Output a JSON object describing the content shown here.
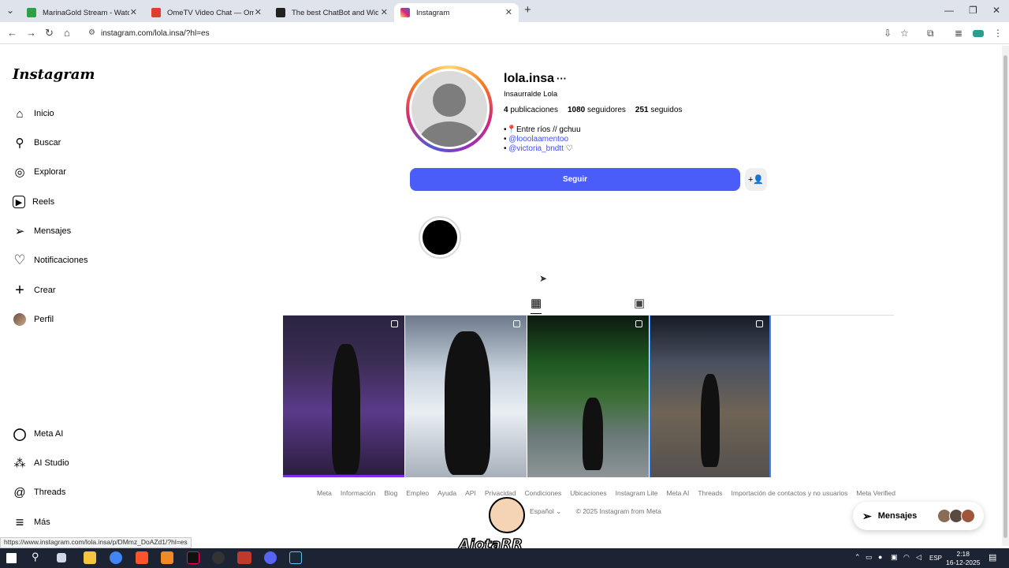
{
  "browser": {
    "tabs": [
      {
        "title": "MarinaGold Stream - Watch Liv",
        "color": "#2ea043"
      },
      {
        "title": "OmeTV Video Chat — Ome",
        "color": "#e03c31"
      },
      {
        "title": "The best ChatBot and Widgets",
        "color": "#222222"
      },
      {
        "title": "Instagram",
        "color": "#d62976"
      }
    ],
    "url": "instagram.com/lola.insa/?hl=es",
    "status_url": "https://www.instagram.com/lola.insa/p/DMmz_DoAZd1/?hl=es"
  },
  "sidebar": {
    "logo": "Instagram",
    "items": [
      {
        "label": "Inicio",
        "icon": "home-icon",
        "glyph": "⌂"
      },
      {
        "label": "Buscar",
        "icon": "search-icon",
        "glyph": "⚲"
      },
      {
        "label": "Explorar",
        "icon": "compass-icon",
        "glyph": "◎"
      },
      {
        "label": "Reels",
        "icon": "reels-icon",
        "glyph": "▶"
      },
      {
        "label": "Mensajes",
        "icon": "send-icon",
        "glyph": "➢"
      },
      {
        "label": "Notificaciones",
        "icon": "heart-icon",
        "glyph": "♡"
      },
      {
        "label": "Crear",
        "icon": "plus-icon",
        "glyph": "+"
      },
      {
        "label": "Perfil",
        "icon": "avatar",
        "glyph": ""
      }
    ],
    "bottom_items": [
      {
        "label": "Meta AI",
        "icon": "meta-ai-icon",
        "glyph": "◯"
      },
      {
        "label": "AI Studio",
        "icon": "ai-studio-icon",
        "glyph": "⁂"
      },
      {
        "label": "Threads",
        "icon": "threads-icon",
        "glyph": "@"
      },
      {
        "label": "Más",
        "icon": "menu-icon",
        "glyph": "≡"
      }
    ]
  },
  "profile": {
    "username": "lola.insa",
    "more": "···",
    "full_name": "Insaurralde Lola",
    "posts_count": "4",
    "posts_label": "publicaciones",
    "followers_count": "1080",
    "followers_label": "seguidores",
    "following_count": "251",
    "following_label": "seguidos",
    "bio_line1": "•📍Entre ríos // gchuu",
    "bio_line2_prefix": "• ",
    "bio_link1": "@looolaamentoo",
    "bio_line3_prefix": "• ",
    "bio_link2": "@victoria_bndtt",
    "bio_heart": "♡",
    "follow_label": "Seguir",
    "suggest_glyph": "+👤"
  },
  "footer": {
    "links": [
      "Meta",
      "Información",
      "Blog",
      "Empleo",
      "Ayuda",
      "API",
      "Privacidad",
      "Condiciones",
      "Ubicaciones",
      "Instagram Lite",
      "Meta AI",
      "Threads",
      "Importación de contactos y no usuarios",
      "Meta Verified"
    ],
    "language": "Español",
    "copyright": "© 2025 Instagram from Meta"
  },
  "messages_pill": {
    "label": "Mensajes"
  },
  "sticker_text": "AjotaRR",
  "taskbar": {
    "lang": "ESP",
    "time": "2:18",
    "date": "16-12-2025"
  },
  "colors": {
    "follow": "#4a5df9",
    "link": "#4150f7"
  }
}
